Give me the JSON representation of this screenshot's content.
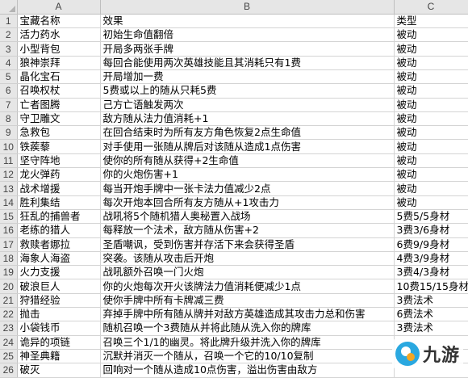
{
  "columns": [
    "A",
    "B",
    "C"
  ],
  "rows": [
    {
      "n": "1",
      "a": "宝藏名称",
      "b": "效果",
      "c": "类型"
    },
    {
      "n": "2",
      "a": "活力药水",
      "b": "初始生命值翻倍",
      "c": "被动"
    },
    {
      "n": "3",
      "a": "小型背包",
      "b": "开局多两张手牌",
      "c": "被动"
    },
    {
      "n": "4",
      "a": "狼神崇拜",
      "b": "每回合能使用两次英雄技能且其消耗只有1费",
      "c": "被动"
    },
    {
      "n": "5",
      "a": "晶化宝石",
      "b": "开局增加一费",
      "c": "被动"
    },
    {
      "n": "6",
      "a": "召唤权杖",
      "b": "5费或以上的随从只耗5费",
      "c": "被动"
    },
    {
      "n": "7",
      "a": "亡者图腾",
      "b": "己方亡语触发两次",
      "c": "被动"
    },
    {
      "n": "8",
      "a": "守卫雕文",
      "b": "敌方随从法力值消耗+1",
      "c": "被动"
    },
    {
      "n": "9",
      "a": "急救包",
      "b": "在回合结束时为所有友方角色恢复2点生命值",
      "c": "被动"
    },
    {
      "n": "10",
      "a": "铁蒺藜",
      "b": "对手使用一张随从牌后对该随从造成1点伤害",
      "c": "被动"
    },
    {
      "n": "11",
      "a": "坚守阵地",
      "b": "使你的所有随从获得+2生命值",
      "c": "被动"
    },
    {
      "n": "12",
      "a": "龙火弹药",
      "b": "你的火炮伤害+1",
      "c": "被动"
    },
    {
      "n": "13",
      "a": "战术增援",
      "b": "每当开炮手牌中一张卡法力值减少2点",
      "c": "被动"
    },
    {
      "n": "14",
      "a": "胜利集结",
      "b": "每次开炮本回合所有友方随从+1攻击力",
      "c": "被动"
    },
    {
      "n": "15",
      "a": "狂乱的捕兽者",
      "b": "战吼将5个随机猎人奥秘置入战场",
      "c": "5费5/5身材"
    },
    {
      "n": "16",
      "a": "老练的猎人",
      "b": "每释放一个法术，敌方随从伤害+2",
      "c": "3费3/6身材"
    },
    {
      "n": "17",
      "a": "救赎者娜拉",
      "b": "圣盾嘲讽，受到伤害并存活下来会获得圣盾",
      "c": "6费9/9身材"
    },
    {
      "n": "18",
      "a": "海象人海盗",
      "b": "突袭。该随从攻击后开炮",
      "c": "4费3/9身材"
    },
    {
      "n": "19",
      "a": "火力支援",
      "b": "战吼额外召唤一门火炮",
      "c": "3费4/3身材"
    },
    {
      "n": "20",
      "a": "破浪巨人",
      "b": "你的火炮每次开火该牌法力值消耗便减少1点",
      "c": "10费15/15身材"
    },
    {
      "n": "21",
      "a": "狩猎经验",
      "b": "使你手牌中所有卡牌减三费",
      "c": "3费法术"
    },
    {
      "n": "22",
      "a": "抛击",
      "b": "弃掉手牌中所有随从牌并对敌方英雄造成其攻击力总和伤害",
      "c": "6费法术"
    },
    {
      "n": "23",
      "a": "小袋钱币",
      "b": "随机召唤一个3费随从并将此随从洗入你的牌库",
      "c": "3费法术"
    },
    {
      "n": "24",
      "a": "诡异的项链",
      "b": "召唤三个1/1的幽灵。将此牌升级并洗入你的牌库",
      "c": ""
    },
    {
      "n": "25",
      "a": "神圣典籍",
      "b": "沉默并消灭一个随从，召唤一个它的10/10复制",
      "c": ""
    },
    {
      "n": "26",
      "a": "破灭",
      "b": "回响对一个随从造成10点伤害，溢出伤害由敌方",
      "c": ""
    }
  ],
  "watermark": {
    "text": "九游",
    "icon": "jiuyou-logo-icon",
    "color": "#2aa8e0"
  }
}
